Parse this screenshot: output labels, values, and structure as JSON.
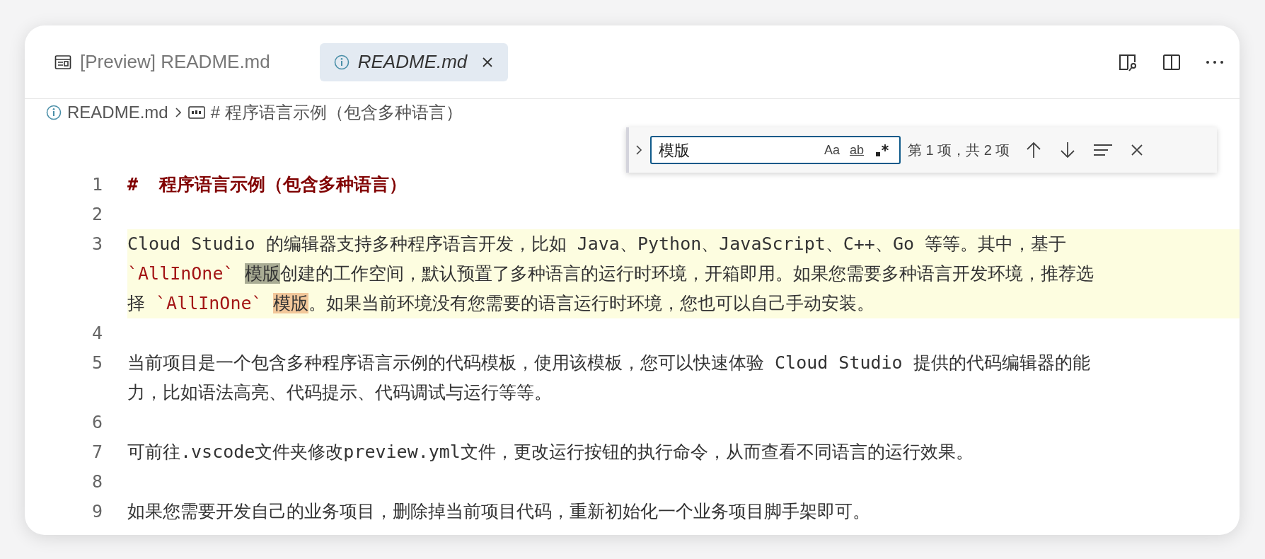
{
  "tabs": [
    {
      "label": "[Preview] README.md",
      "kind": "preview",
      "selected": false
    },
    {
      "label": "README.md",
      "kind": "file",
      "selected": true
    }
  ],
  "breadcrumb": [
    {
      "label": "README.md",
      "kind": "file"
    },
    {
      "label": "# 程序语言示例（包含多种语言）",
      "kind": "heading"
    }
  ],
  "find": {
    "value": "模版",
    "toggles": [
      {
        "kind": "case",
        "label": "Aa",
        "on": false
      },
      {
        "kind": "word",
        "label": "ab",
        "on": false
      },
      {
        "kind": "regex",
        "on": false
      }
    ],
    "count": "第 1 项，共 2 项"
  },
  "lines": [
    {
      "number": "1",
      "highlighted": false,
      "rows": [
        [
          {
            "kind": "heading",
            "text": "#  程序语言示例（包含多种语言）"
          }
        ]
      ]
    },
    {
      "number": "2",
      "highlighted": false
    },
    {
      "number": "3",
      "highlighted": true,
      "rows": [
        [
          {
            "kind": "plain",
            "text": "Cloud Studio 的编辑器支持多种程序语言开发，比如 Java、Python、JavaScript、C++、Go 等等。其中，基于"
          }
        ],
        [
          {
            "kind": "code",
            "text": "`AllInOne`"
          },
          {
            "kind": "plain",
            "text": " "
          },
          {
            "kind": "selection",
            "text": "模版"
          },
          {
            "kind": "plain",
            "text": "创建的工作空间，默认预置了多种语言的运行时环境，开箱即用。如果您需要多种语言开发环境，推荐选"
          }
        ],
        [
          {
            "kind": "plain",
            "text": "择 "
          },
          {
            "kind": "code",
            "text": "`AllInOne`"
          },
          {
            "kind": "plain",
            "text": " "
          },
          {
            "kind": "match",
            "text": "模版"
          },
          {
            "kind": "plain",
            "text": "。如果当前环境没有您需要的语言运行时环境，您也可以自己手动安装。"
          }
        ]
      ]
    },
    {
      "number": "4",
      "highlighted": false
    },
    {
      "number": "5",
      "highlighted": false,
      "rows": [
        [
          {
            "kind": "plain",
            "text": "当前项目是一个包含多种程序语言示例的代码模板，使用该模板，您可以快速体验 Cloud Studio 提供的代码编辑器的能"
          }
        ],
        [
          {
            "kind": "plain",
            "text": "力，比如语法高亮、代码提示、代码调试与运行等等。"
          }
        ]
      ]
    },
    {
      "number": "6",
      "highlighted": false
    },
    {
      "number": "7",
      "highlighted": false,
      "rows": [
        [
          {
            "kind": "plain",
            "text": "可前往.vscode文件夹修改preview.yml文件，更改运行按钮的执行命令，从而查看不同语言的运行效果。"
          }
        ]
      ]
    },
    {
      "number": "8",
      "highlighted": false
    },
    {
      "number": "9",
      "highlighted": false,
      "rows": [
        [
          {
            "kind": "plain",
            "text": "如果您需要开发自己的业务项目，删除掉当前项目代码，重新初始化一个业务项目脚手架即可。"
          }
        ]
      ]
    }
  ]
}
